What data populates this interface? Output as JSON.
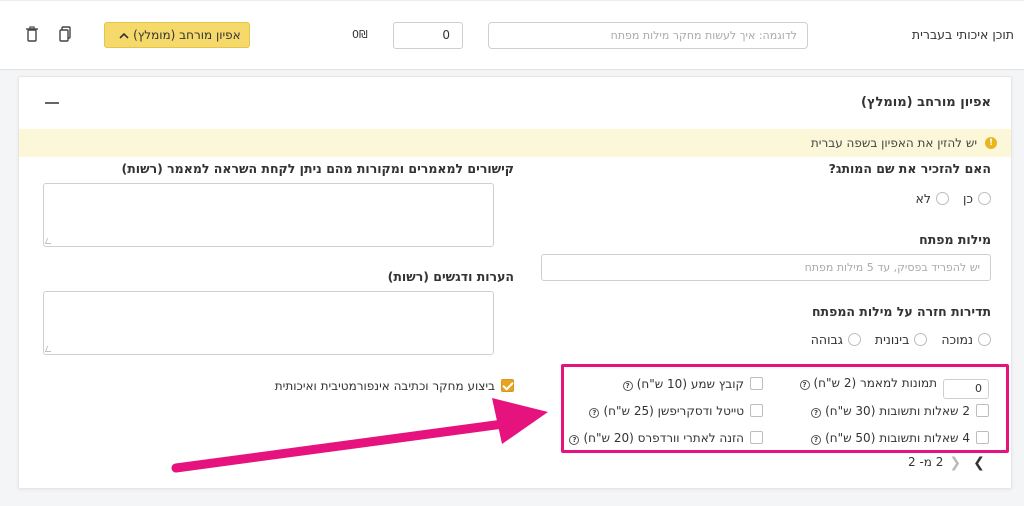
{
  "top_row": {
    "label": "תוכן איכותי בעברית",
    "keyword_placeholder": "לדוגמה: איך לעשות מחקר מילות מפתח",
    "quantity_value": "0",
    "price": "0₪",
    "advanced_button_label": "אפיון מורחב (מומלץ)"
  },
  "panel": {
    "title": "אפיון מורחב (מומלץ)",
    "warning": "יש להזין את האפיון בשפה עברית",
    "brand_question": "האם להזכיר את שם המותג?",
    "brand_options": [
      "כן",
      "לא"
    ],
    "keywords_label": "מילות מפתח",
    "keywords_placeholder": "יש להפריד בפסיק, עד 5 מילות מפתח",
    "frequency_label": "תדירות חזרה על מילות המפתח",
    "frequency_options": [
      "נמוכה",
      "בינונית",
      "גבוהה"
    ],
    "links_label": "קישורים למאמרים ומקורות מהם ניתן לקחת השראה למאמר (רשות)",
    "notes_label": "הערות ודגשים (רשות)",
    "research_label": "ביצוע מחקר וכתיבה אינפורמטיבית ואיכותית",
    "addons": {
      "images_qty": "0",
      "images_label": "תמונות למאמר (2 ש\"ח)",
      "qa2_label": "2 שאלות ותשובות (30 ש\"ח)",
      "qa4_label": "4 שאלות ותשובות (50 ש\"ח)",
      "audio_label": "קובץ שמע (10 ש\"ח)",
      "title_desc_label": "טייטל ודסקריפשן (25 ש\"ח)",
      "wordpress_label": "הזנה לאתרי וורדפרס (20 ש\"ח)"
    },
    "pager": "2 מ- 2"
  },
  "colors": {
    "accent": "#f5d96b",
    "highlight": "#e6137e",
    "checked": "#e8a420"
  }
}
